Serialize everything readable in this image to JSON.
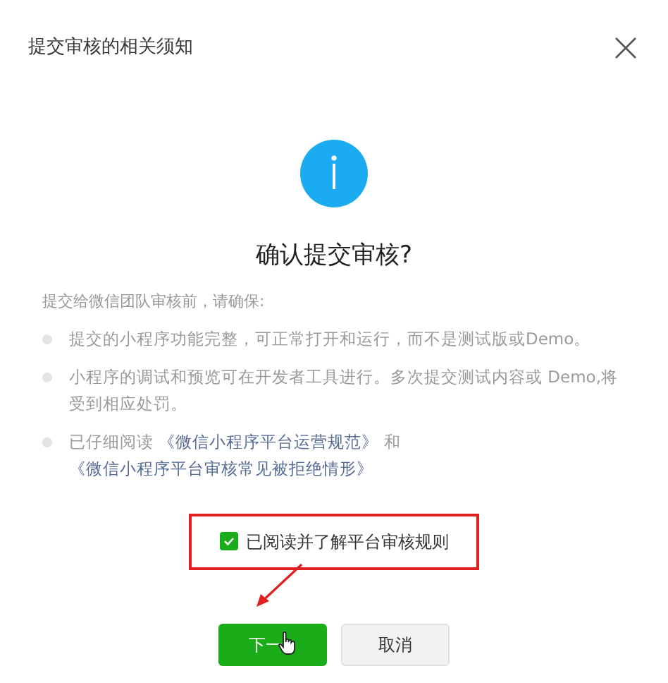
{
  "dialog": {
    "title": "提交审核的相关须知",
    "heading": "确认提交审核?",
    "intro": "提交给微信团队审核前，请确保:",
    "items": [
      {
        "parts": [
          {
            "kind": "text",
            "text": "提交的小程序功能完整，可正常打开和运行，而不是测试版或Demo。"
          }
        ]
      },
      {
        "parts": [
          {
            "kind": "text",
            "text": "小程序的调试和预览可在开发者工具进行。多次提交测试内容或 Demo,将受到相应处罚。"
          }
        ]
      },
      {
        "parts": [
          {
            "kind": "text",
            "text": "已仔细阅读 "
          },
          {
            "kind": "link",
            "text": "《微信小程序平台运营规范》"
          },
          {
            "kind": "text",
            "text": " 和 "
          },
          {
            "kind": "link",
            "text": "《微信小程序平台审核常见被拒绝情形》"
          }
        ]
      }
    ],
    "agreement": {
      "label": "已阅读并了解平台审核规则",
      "checked": true
    },
    "buttons": [
      {
        "label": "下一",
        "kind": "primary"
      },
      {
        "label": "取消",
        "kind": "secondary"
      }
    ]
  }
}
